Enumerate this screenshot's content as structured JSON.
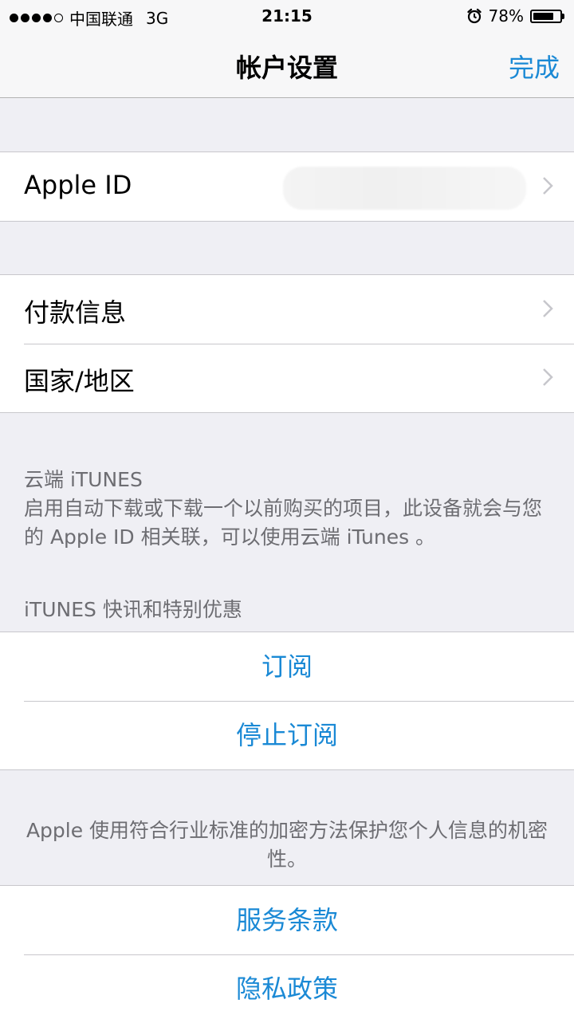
{
  "status_bar": {
    "carrier": "中国联通",
    "network": "3G",
    "time": "21:15",
    "battery_percent": "78%",
    "battery_level": 0.78,
    "signal_bars_filled": 4,
    "signal_bars_total": 5
  },
  "nav": {
    "title": "帐户设置",
    "done_label": "完成"
  },
  "account": {
    "apple_id_label": "Apple ID"
  },
  "settings": {
    "payment_label": "付款信息",
    "region_label": "国家/地区"
  },
  "cloud": {
    "header": "云端 iTUNES",
    "description": "启用自动下载或下载一个以前购买的项目，此设备就会与您的 Apple ID 相关联，可以使用云端 iTunes 。"
  },
  "newsletter": {
    "header": "iTUNES 快讯和特别优惠",
    "subscribe_label": "订阅",
    "unsubscribe_label": "停止订阅"
  },
  "security": {
    "note": "Apple 使用符合行业标准的加密方法保护您个人信息的机密性。"
  },
  "legal": {
    "terms_label": "服务条款",
    "privacy_label": "隐私政策"
  },
  "colors": {
    "accent": "#1a89d5",
    "background": "#efeff4",
    "secondary_text": "#6d6d72"
  }
}
